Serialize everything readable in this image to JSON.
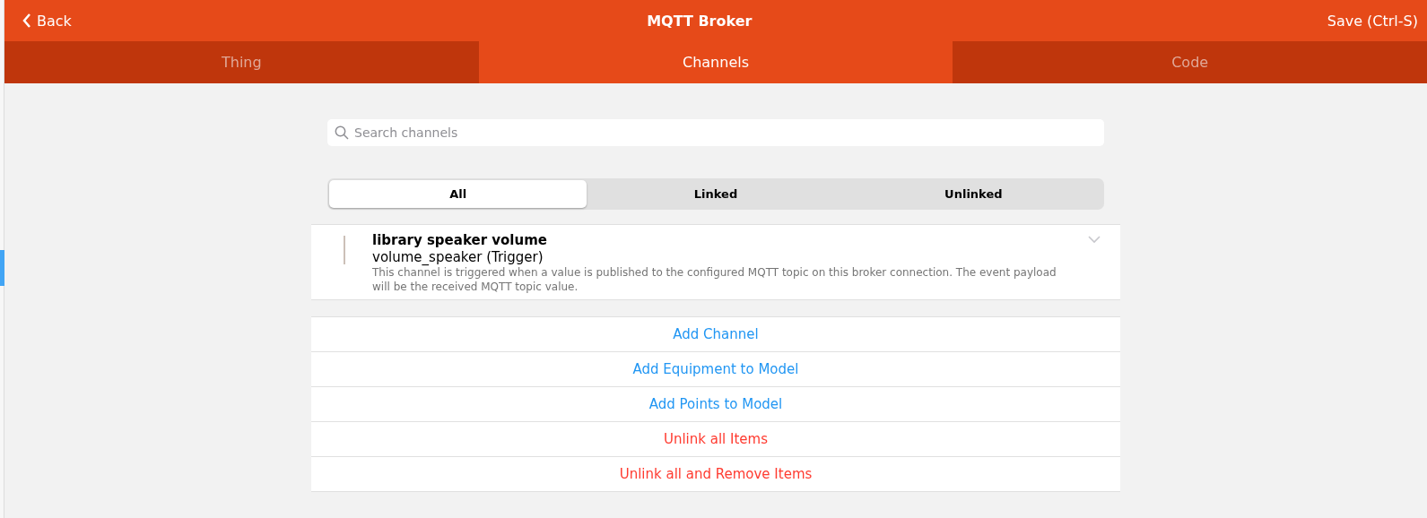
{
  "navbar": {
    "back": "Back",
    "title": "MQTT Broker",
    "save": "Save (Ctrl-S)"
  },
  "tabs": [
    {
      "label": "Thing",
      "selected": false
    },
    {
      "label": "Channels",
      "selected": true
    },
    {
      "label": "Code",
      "selected": false
    }
  ],
  "search": {
    "placeholder": "Search channels"
  },
  "filters": [
    {
      "label": "All",
      "selected": true
    },
    {
      "label": "Linked",
      "selected": false
    },
    {
      "label": "Unlinked",
      "selected": false
    }
  ],
  "channels": [
    {
      "label": "library speaker volume",
      "id": "volume_speaker (Trigger)",
      "description": "This channel is triggered when a value is published to the configured MQTT topic on this broker connection. The event payload will be the received MQTT topic value.",
      "expanded": false
    }
  ],
  "actions": [
    {
      "label": "Add Channel",
      "kind": "normal"
    },
    {
      "label": "Add Equipment to Model",
      "kind": "normal"
    },
    {
      "label": "Add Points to Model",
      "kind": "normal"
    },
    {
      "label": "Unlink all Items",
      "kind": "danger"
    },
    {
      "label": "Unlink all and Remove Items",
      "kind": "danger"
    }
  ]
}
